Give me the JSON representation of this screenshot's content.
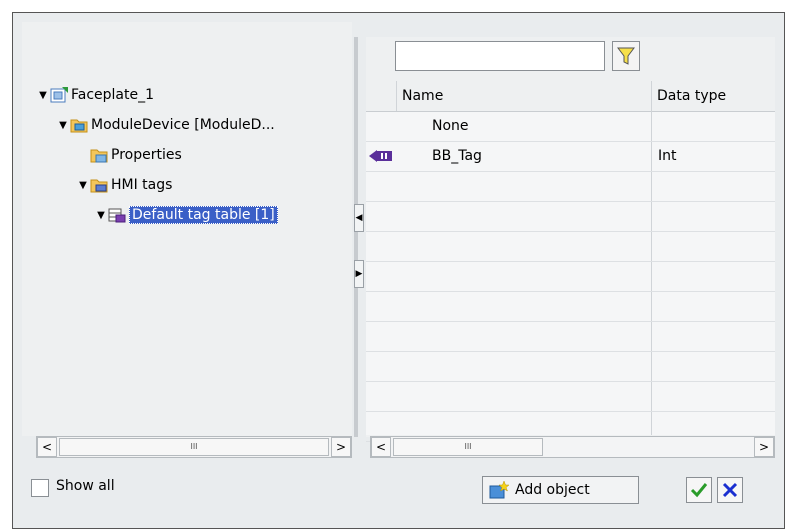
{
  "tree": {
    "items": [
      {
        "label": "Faceplate_1",
        "icon": "faceplate-icon"
      },
      {
        "label": "ModuleDevice [ModuleD...",
        "icon": "device-folder-icon"
      },
      {
        "label": "Properties",
        "icon": "properties-folder-icon"
      },
      {
        "label": "HMI tags",
        "icon": "hmi-tags-folder-icon"
      },
      {
        "label": "Default tag table [1]",
        "icon": "tag-table-icon"
      }
    ]
  },
  "search": {
    "value": "",
    "placeholder": ""
  },
  "table": {
    "columns": [
      "Name",
      "Data type"
    ],
    "rows": [
      {
        "name": "None",
        "type": ""
      },
      {
        "name": "BB_Tag",
        "type": "Int",
        "icon": "tag-icon"
      }
    ]
  },
  "footer": {
    "show_all_label": "Show all",
    "add_object_label": "Add object"
  },
  "scroll": {
    "left_thumb": "III",
    "right_thumb": "III"
  },
  "colors": {
    "selection": "#3a5fc7",
    "ok": "#2a9c2a",
    "cancel": "#1a2fd0"
  }
}
